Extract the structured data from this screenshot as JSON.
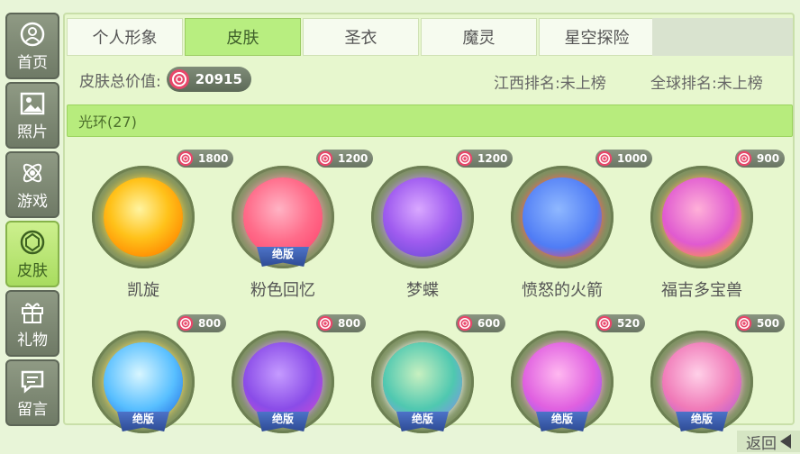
{
  "sidebar": {
    "items": [
      {
        "label": "首页",
        "icon": "home-icon"
      },
      {
        "label": "照片",
        "icon": "photo-icon"
      },
      {
        "label": "游戏",
        "icon": "game-icon"
      },
      {
        "label": "皮肤",
        "icon": "skin-icon"
      },
      {
        "label": "礼物",
        "icon": "gift-icon"
      },
      {
        "label": "留言",
        "icon": "message-icon"
      }
    ]
  },
  "tabs": [
    "个人形象",
    "皮肤",
    "圣衣",
    "魔灵",
    "星空探险"
  ],
  "info": {
    "total_label": "皮肤总价值:",
    "total_value": "20915",
    "rank_jiangxi": "江西排名:未上榜",
    "rank_global": "全球排名:未上榜"
  },
  "category": "光环(27)",
  "items": [
    {
      "name": "凯旋",
      "price": "1800",
      "badge": ""
    },
    {
      "name": "粉色回忆",
      "price": "1200",
      "badge": "绝版"
    },
    {
      "name": "梦蝶",
      "price": "1200",
      "badge": ""
    },
    {
      "name": "愤怒的火箭",
      "price": "1000",
      "badge": ""
    },
    {
      "name": "福吉多宝兽",
      "price": "900",
      "badge": ""
    },
    {
      "name": "",
      "price": "800",
      "badge": "绝版"
    },
    {
      "name": "",
      "price": "800",
      "badge": "绝版"
    },
    {
      "name": "",
      "price": "600",
      "badge": "绝版"
    },
    {
      "name": "",
      "price": "520",
      "badge": "绝版"
    },
    {
      "name": "",
      "price": "500",
      "badge": "绝版"
    }
  ],
  "back_label": "返回",
  "colors": {
    "active_tab": "#b8ee80",
    "category_bar": "#b7ec7d",
    "ring": "#7d9161"
  }
}
